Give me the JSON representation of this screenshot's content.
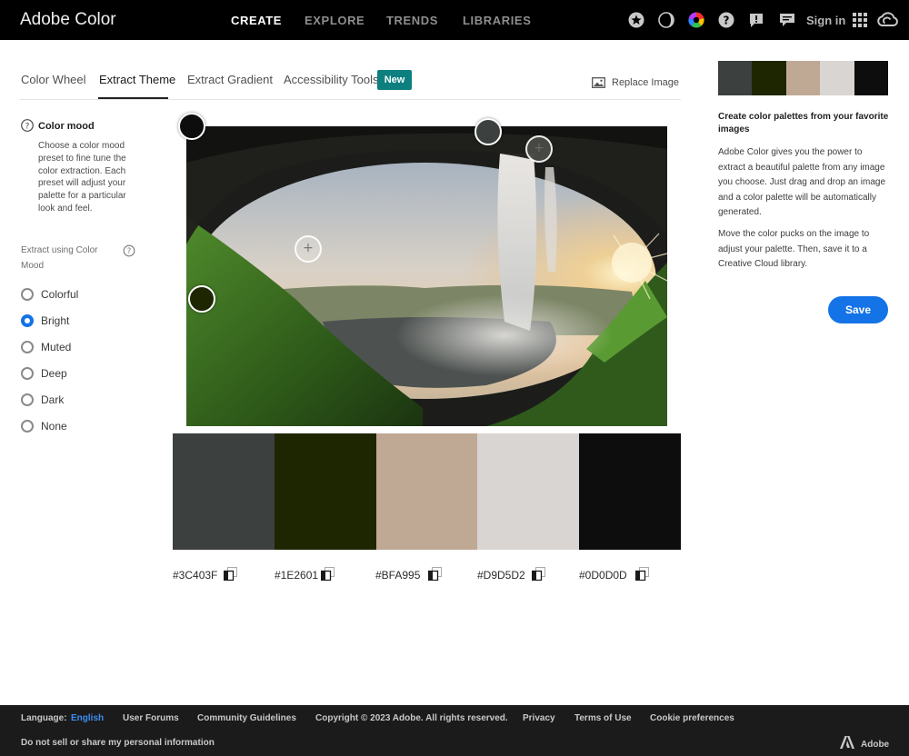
{
  "header": {
    "app_title": "Adobe Color",
    "tabs": [
      {
        "label": "CREATE",
        "active": true
      },
      {
        "label": "EXPLORE",
        "active": false
      },
      {
        "label": "TRENDS",
        "active": false
      },
      {
        "label": "LIBRARIES",
        "active": false
      }
    ],
    "icons": [
      "star-badge-icon",
      "moon-icon",
      "color-wheel-icon",
      "help-icon",
      "feedback-icon",
      "chat-icon",
      "apps-grid-icon",
      "creative-cloud-icon"
    ],
    "signin_label": "Sign in"
  },
  "subtabs": [
    {
      "label": "Color Wheel",
      "active": false
    },
    {
      "label": "Extract Theme",
      "active": true
    },
    {
      "label": "Extract Gradient",
      "active": false
    },
    {
      "label": "Accessibility Tools",
      "active": false
    }
  ],
  "new_badge": "New",
  "replace_image_label": "Replace Image",
  "color_mood": {
    "title": "Color mood",
    "description": "Choose a color mood preset to fine tune the color extraction. Each preset will adjust your palette for a particular look and feel.",
    "extract_label": "Extract using Color Mood",
    "options": [
      {
        "label": "Colorful",
        "selected": false
      },
      {
        "label": "Bright",
        "selected": true
      },
      {
        "label": "Muted",
        "selected": false
      },
      {
        "label": "Deep",
        "selected": false
      },
      {
        "label": "Dark",
        "selected": false
      },
      {
        "label": "None",
        "selected": false
      }
    ]
  },
  "palette": [
    {
      "hex": "#3C403F",
      "color": "#3C403F"
    },
    {
      "hex": "#1E2601",
      "color": "#1E2601"
    },
    {
      "hex": "#BFA995",
      "color": "#BFA995"
    },
    {
      "hex": "#D9D5D2",
      "color": "#D9D5D2"
    },
    {
      "hex": "#0D0D0D",
      "color": "#0D0D0D"
    }
  ],
  "right_panel": {
    "title": "Create color palettes from your favorite images",
    "paragraph1": "Adobe Color gives you the power to extract a beautiful palette from any image you choose. Just drag and drop an image and a color palette will be automatically generated.",
    "paragraph2": "Move the color pucks on the image to adjust your palette. Then, save it to a Creative Cloud library.",
    "save_label": "Save"
  },
  "footer": {
    "language_label": "Language:",
    "language_value": "English",
    "links": [
      "User Forums",
      "Community Guidelines",
      "Copyright © 2023 Adobe. All rights reserved.",
      "Privacy",
      "Terms of Use",
      "Cookie preferences"
    ],
    "do_not_sell": "Do not sell or share my personal information",
    "adobe_label": "Adobe"
  },
  "colors": {
    "accent": "#1473E6",
    "new_badge": "#0D7F7F",
    "footer_link": "#3D8EF2"
  }
}
